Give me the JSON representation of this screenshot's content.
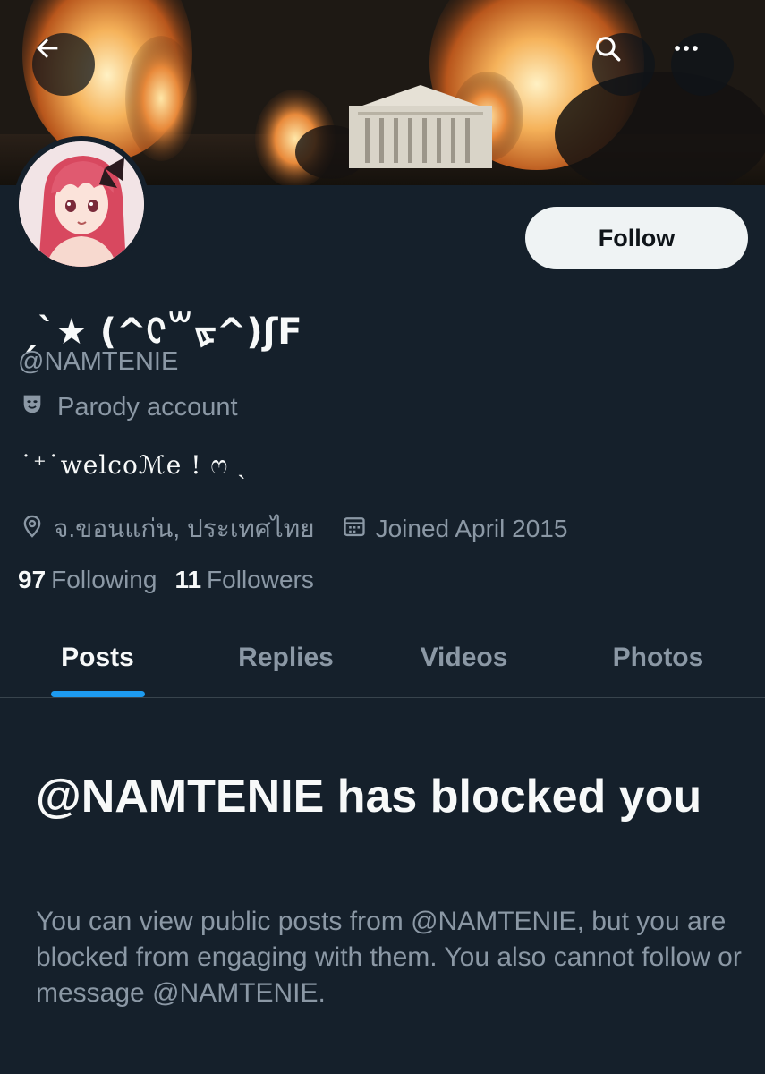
{
  "header": {
    "banner_icon": "burning-white-house-photo",
    "back_icon": "arrow-left-icon",
    "search_icon": "search-icon",
    "more_icon": "more-horizontal-icon"
  },
  "profile": {
    "avatar_icon": "anime-girl-avatar",
    "follow_label": "Follow",
    "display_name": "ˏˋ★ (^ᢗ꒳ᢘ^)ʃF",
    "handle": "@NAMTENIE",
    "parody_icon": "theater-mask-icon",
    "parody_label": "Parody account",
    "bio": "˙⁺˙welcoℳe ! ෆ ˎ",
    "location_icon": "location-pin-icon",
    "location": "จ.ขอนแก่น, ประเทศไทย",
    "calendar_icon": "calendar-icon",
    "joined": "Joined April 2015",
    "following_count": "97",
    "following_label": "Following",
    "followers_count": "11",
    "followers_label": "Followers"
  },
  "tabs": [
    {
      "label": "Posts",
      "active": true
    },
    {
      "label": "Replies",
      "active": false
    },
    {
      "label": "Videos",
      "active": false
    },
    {
      "label": "Photos",
      "active": false
    }
  ],
  "blocked": {
    "title": "@NAMTENIE has blocked you",
    "description": "You can view public posts from @NAMTENIE, but you are blocked from engaging with them. You also cannot follow or message @NAMTENIE."
  },
  "colors": {
    "background": "#15202b",
    "accent": "#1d9bf0",
    "secondary_text": "#8b98a5",
    "follow_bg": "#eff3f4"
  }
}
